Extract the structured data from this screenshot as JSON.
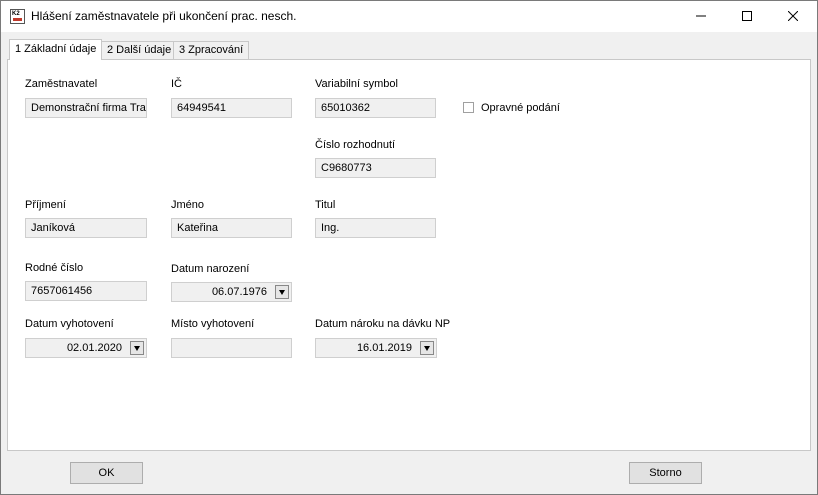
{
  "window": {
    "title": "Hlášení zaměstnavatele při ukončení prac. nesch.",
    "app_icon_text": "K2"
  },
  "tabs": [
    {
      "label": "1 Základní údaje"
    },
    {
      "label": "2 Další údaje"
    },
    {
      "label": "3 Zpracování"
    }
  ],
  "form": {
    "zamestnavatel": {
      "label": "Zaměstnavatel",
      "value": "Demonstrační firma Trade"
    },
    "ic": {
      "label": "IČ",
      "value": "64949541"
    },
    "variabilni_symbol": {
      "label": "Variabilní symbol",
      "value": "65010362"
    },
    "opravne_podani": {
      "label": "Opravné podání",
      "checked": false
    },
    "cislo_rozhodnuti": {
      "label": "Číslo rozhodnutí",
      "value": "C9680773"
    },
    "prijmeni": {
      "label": "Příjmení",
      "value": "Janíková"
    },
    "jmeno": {
      "label": "Jméno",
      "value": "Kateřina"
    },
    "titul": {
      "label": "Titul",
      "value": "Ing."
    },
    "rodne_cislo": {
      "label": "Rodné číslo",
      "value": "7657061456"
    },
    "datum_narozeni": {
      "label": "Datum narození",
      "value": "06.07.1976"
    },
    "datum_vyhotoveni": {
      "label": "Datum vyhotovení",
      "value": "02.01.2020"
    },
    "misto_vyhotoveni": {
      "label": "Místo vyhotovení",
      "value": ""
    },
    "datum_naroku": {
      "label": "Datum nároku na dávku NP",
      "value": "16.01.2019"
    }
  },
  "buttons": {
    "ok": "OK",
    "storno": "Storno"
  }
}
